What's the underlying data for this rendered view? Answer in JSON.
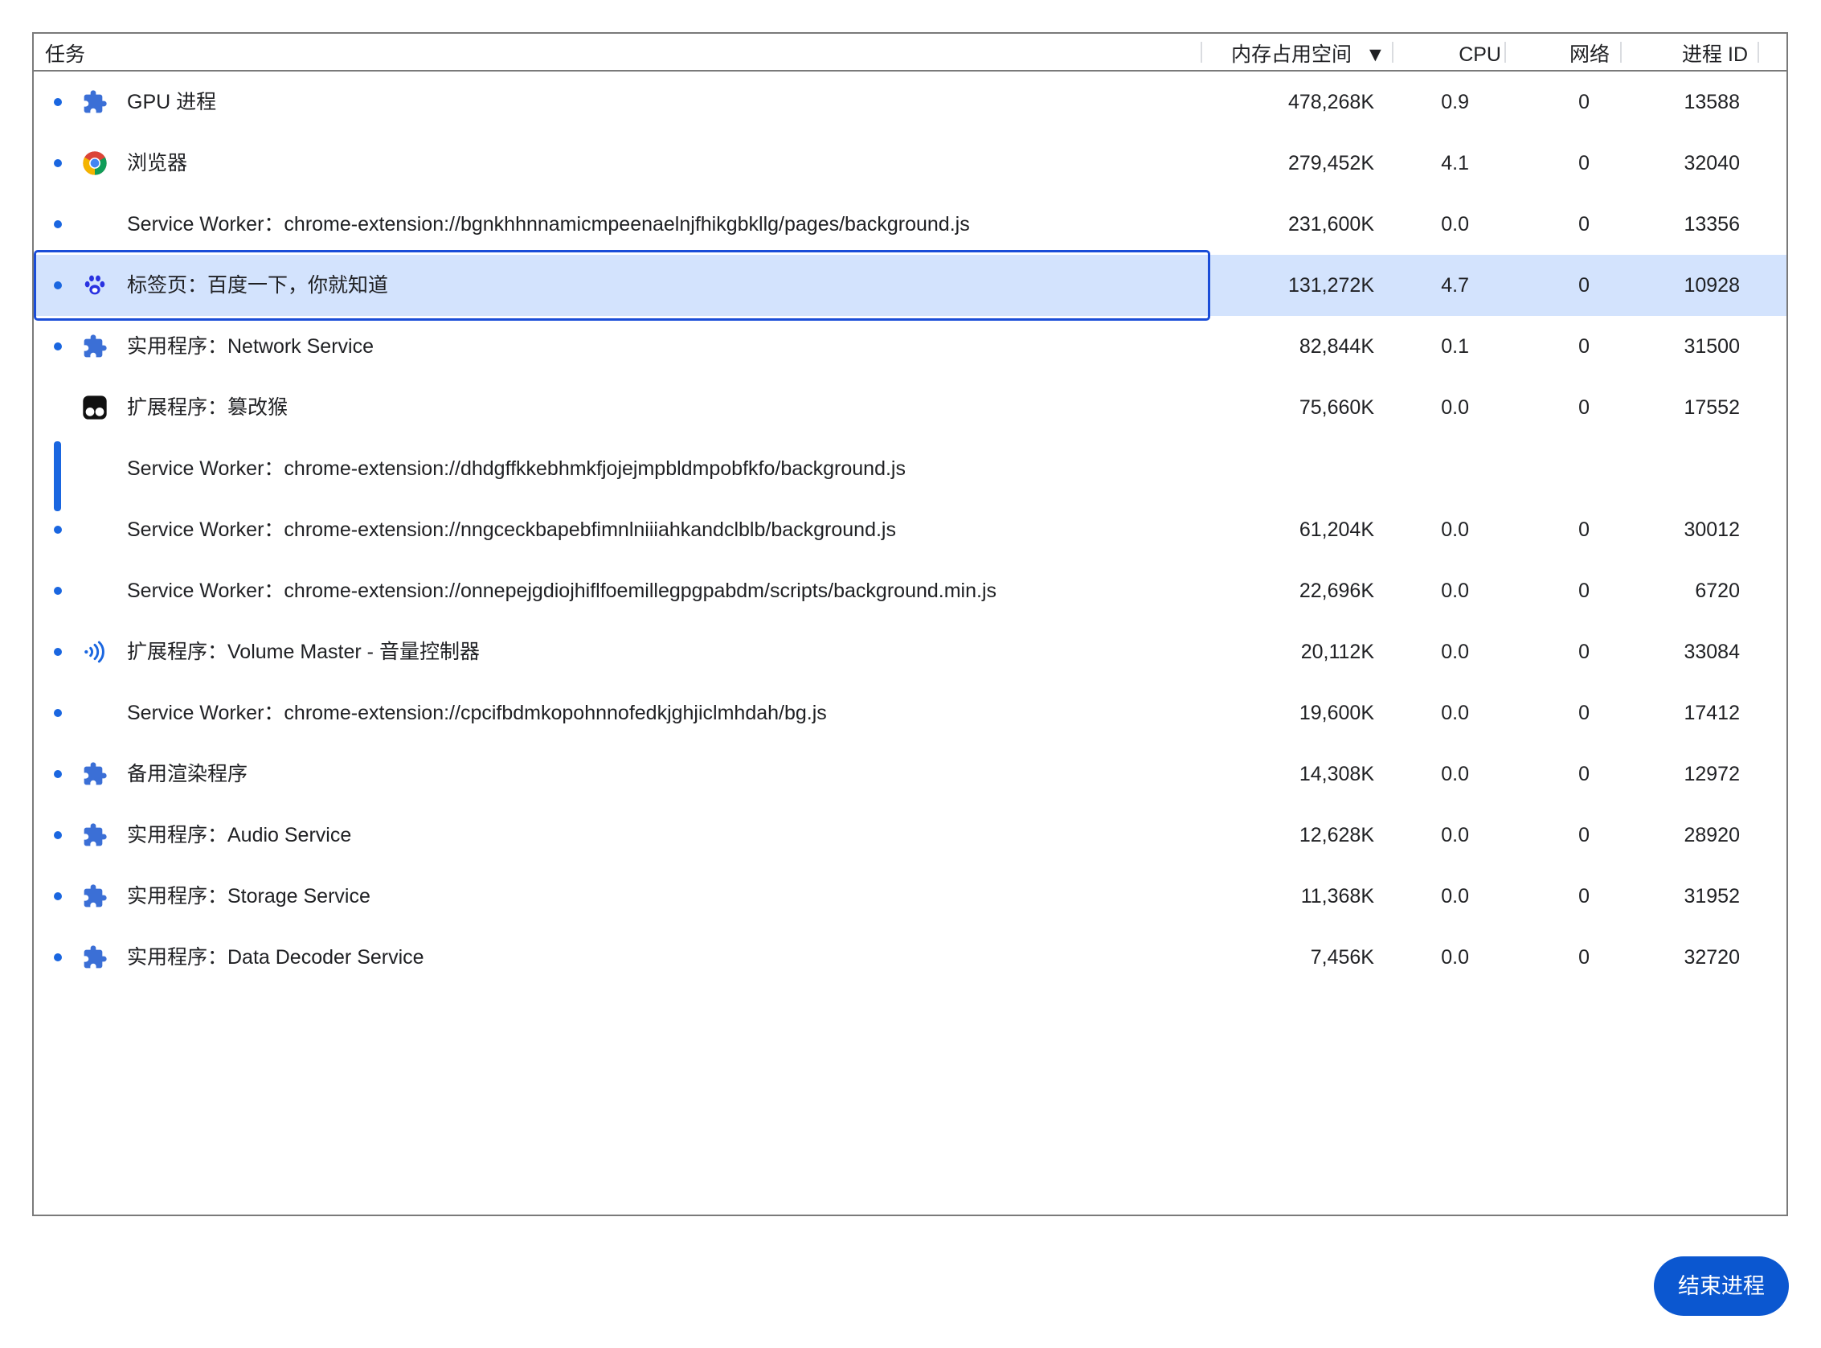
{
  "header": {
    "task": "任务",
    "memory": "内存占用空间",
    "sort_indicator": "▼",
    "cpu": "CPU",
    "network": "网络",
    "pid": "进程 ID"
  },
  "rows": [
    {
      "icon": "puzzle-icon",
      "task": "GPU 进程",
      "memory": "478,268K",
      "cpu": "0.9",
      "network": "0",
      "pid": "13588"
    },
    {
      "icon": "chrome-icon",
      "task": "浏览器",
      "memory": "279,452K",
      "cpu": "4.1",
      "network": "0",
      "pid": "32040"
    },
    {
      "icon": "",
      "task": "Service Worker：chrome-extension://bgnkhhnnamicmpeenaelnjfhikgbkllg/pages/background.js",
      "memory": "231,600K",
      "cpu": "0.0",
      "network": "0",
      "pid": "13356"
    },
    {
      "icon": "baidu-paw-icon",
      "task": "标签页：百度一下，你就知道",
      "memory": "131,272K",
      "cpu": "4.7",
      "network": "0",
      "pid": "10928"
    },
    {
      "icon": "puzzle-icon",
      "task": "实用程序：Network Service",
      "memory": "82,844K",
      "cpu": "0.1",
      "network": "0",
      "pid": "31500"
    },
    {
      "icon": "tampermonkey-icon",
      "task": "扩展程序：篡改猴",
      "memory": "75,660K",
      "cpu": "0.0",
      "network": "0",
      "pid": "17552"
    },
    {
      "icon": "",
      "task": "Service Worker：chrome-extension://dhdgffkkebhmkfjojejmpbldmpobfkfo/background.js",
      "memory": "",
      "cpu": "",
      "network": "",
      "pid": ""
    },
    {
      "icon": "",
      "task": "Service Worker：chrome-extension://nngceckbapebfimnlniiiahkandclblb/background.js",
      "memory": "61,204K",
      "cpu": "0.0",
      "network": "0",
      "pid": "30012"
    },
    {
      "icon": "",
      "task": "Service Worker：chrome-extension://onnepejgdiojhiflfoemillegpgpabdm/scripts/background.min.js",
      "memory": "22,696K",
      "cpu": "0.0",
      "network": "0",
      "pid": "6720"
    },
    {
      "icon": "volume-icon",
      "task": "扩展程序：Volume Master - 音量控制器",
      "memory": "20,112K",
      "cpu": "0.0",
      "network": "0",
      "pid": "33084"
    },
    {
      "icon": "",
      "task": "Service Worker：chrome-extension://cpcifbdmkopohnnofedkjghjiclmhdah/bg.js",
      "memory": "19,600K",
      "cpu": "0.0",
      "network": "0",
      "pid": "17412"
    },
    {
      "icon": "puzzle-icon",
      "task": "备用渲染程序",
      "memory": "14,308K",
      "cpu": "0.0",
      "network": "0",
      "pid": "12972"
    },
    {
      "icon": "puzzle-icon",
      "task": "实用程序：Audio Service",
      "memory": "12,628K",
      "cpu": "0.0",
      "network": "0",
      "pid": "28920"
    },
    {
      "icon": "puzzle-icon",
      "task": "实用程序：Storage Service",
      "memory": "11,368K",
      "cpu": "0.0",
      "network": "0",
      "pid": "31952"
    },
    {
      "icon": "puzzle-icon",
      "task": "实用程序：Data Decoder Service",
      "memory": "7,456K",
      "cpu": "0.0",
      "network": "0",
      "pid": "32720"
    }
  ],
  "selected_row": 3,
  "end_process_button": "结束进程",
  "colors": {
    "accent": "#0b57d0",
    "selection": "#d3e3fd",
    "dot": "#1a66e0"
  }
}
